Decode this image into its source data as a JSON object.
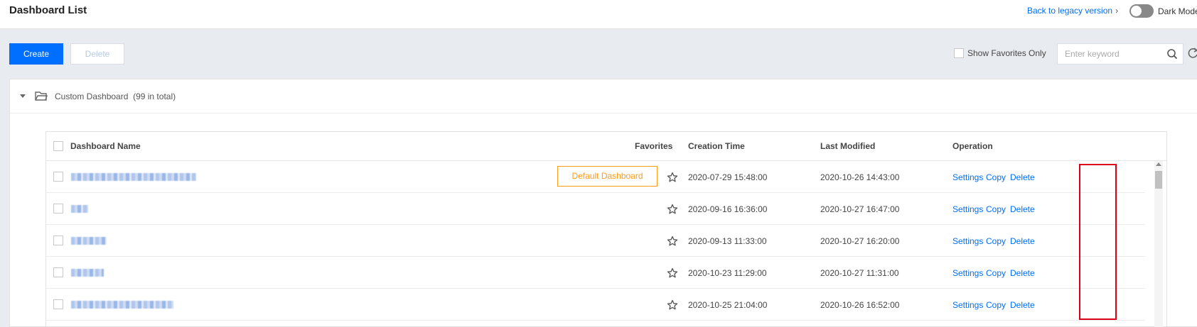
{
  "header": {
    "title": "Dashboard List",
    "legacy_link": "Back to legacy version",
    "dark_mode_label": "Dark Mode",
    "dark_mode_on": false
  },
  "toolbar": {
    "create_label": "Create",
    "delete_label": "Delete",
    "favorites_only_label": "Show Favorites Only",
    "search_placeholder": "Enter keyword"
  },
  "folder": {
    "name": "Custom Dashboard",
    "count_open": "(",
    "count": "99",
    "count_suffix": " in total)"
  },
  "table": {
    "columns": {
      "name": "Dashboard Name",
      "favorites": "Favorites",
      "created": "Creation Time",
      "modified": "Last Modified",
      "operation": "Operation"
    },
    "default_tag": "Default Dashboard",
    "rows": [
      {
        "created": "2020-07-29 15:48:00",
        "modified": "2020-10-26 14:43:00",
        "settings": "Settings",
        "copy": "Copy",
        "delete": "Delete"
      },
      {
        "created": "2020-09-16 16:36:00",
        "modified": "2020-10-27 16:47:00",
        "settings": "Settings",
        "copy": "Copy",
        "delete": "Delete"
      },
      {
        "created": "2020-09-13 11:33:00",
        "modified": "2020-10-27 16:20:00",
        "settings": "Settings",
        "copy": "Copy",
        "delete": "Delete"
      },
      {
        "created": "2020-10-23 11:29:00",
        "modified": "2020-10-27 11:31:00",
        "settings": "Settings",
        "copy": "Copy",
        "delete": "Delete"
      },
      {
        "created": "2020-10-25 21:04:00",
        "modified": "2020-10-26 16:52:00",
        "settings": "Settings",
        "copy": "Copy",
        "delete": "Delete"
      }
    ]
  },
  "colors": {
    "accent": "#006eff",
    "default_tag": "#ff9c19",
    "highlight": "#d9001b"
  },
  "icons": [
    "chevron-right-icon",
    "search-icon",
    "refresh-icon",
    "caret-down-icon",
    "folder-icon",
    "star-icon"
  ]
}
